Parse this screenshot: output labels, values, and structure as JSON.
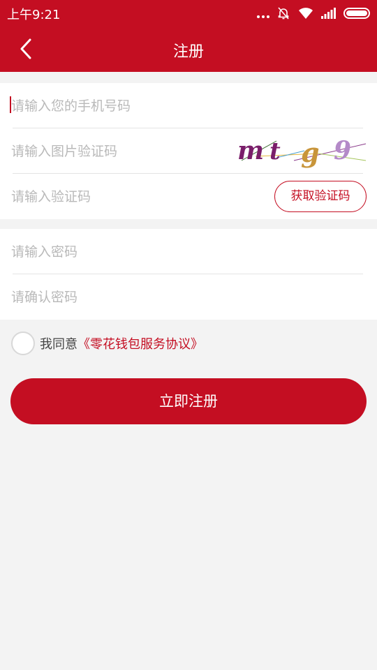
{
  "status_bar": {
    "time": "上午9:21",
    "icons": [
      "more-dots-icon",
      "bell-off-icon",
      "wifi-icon",
      "signal-icon",
      "battery-icon"
    ]
  },
  "header": {
    "title": "注册",
    "back_icon": "chevron-left-icon"
  },
  "form": {
    "phone": {
      "placeholder": "请输入您的手机号码"
    },
    "image_code": {
      "placeholder": "请输入图片验证码",
      "captcha_text": "mtg9"
    },
    "sms_code": {
      "placeholder": "请输入验证码",
      "button_label": "获取验证码"
    },
    "password": {
      "placeholder": "请输入密码"
    },
    "confirm_password": {
      "placeholder": "请确认密码"
    }
  },
  "agreement": {
    "prefix": "我同意",
    "link": "《零花钱包服务协议》",
    "checked": false
  },
  "submit": {
    "label": "立即注册"
  },
  "colors": {
    "brand": "#c40e22",
    "background": "#f3f3f3",
    "placeholder": "#b9b9b9"
  }
}
